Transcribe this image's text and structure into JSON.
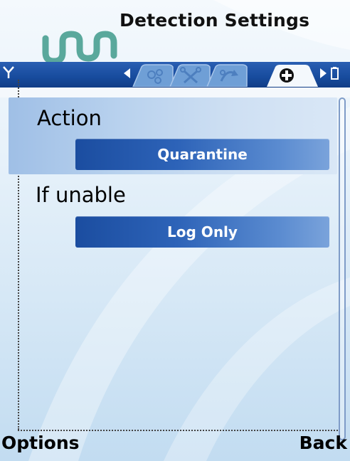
{
  "title": "Detection Settings",
  "tabs": [
    {
      "icon": "virus-icon",
      "active": false
    },
    {
      "icon": "tools-icon",
      "active": false
    },
    {
      "icon": "update-icon",
      "active": false
    },
    {
      "icon": "first-aid-icon",
      "active": true
    }
  ],
  "settings": [
    {
      "label": "Action",
      "value": "Quarantine"
    },
    {
      "label": "If unable",
      "value": "Log Only"
    }
  ],
  "softkeys": {
    "left": "Options",
    "right": "Back"
  },
  "colors": {
    "accent": "#1b4da0",
    "tab_bar": "#174b9d",
    "logo": "#5aa89c"
  }
}
